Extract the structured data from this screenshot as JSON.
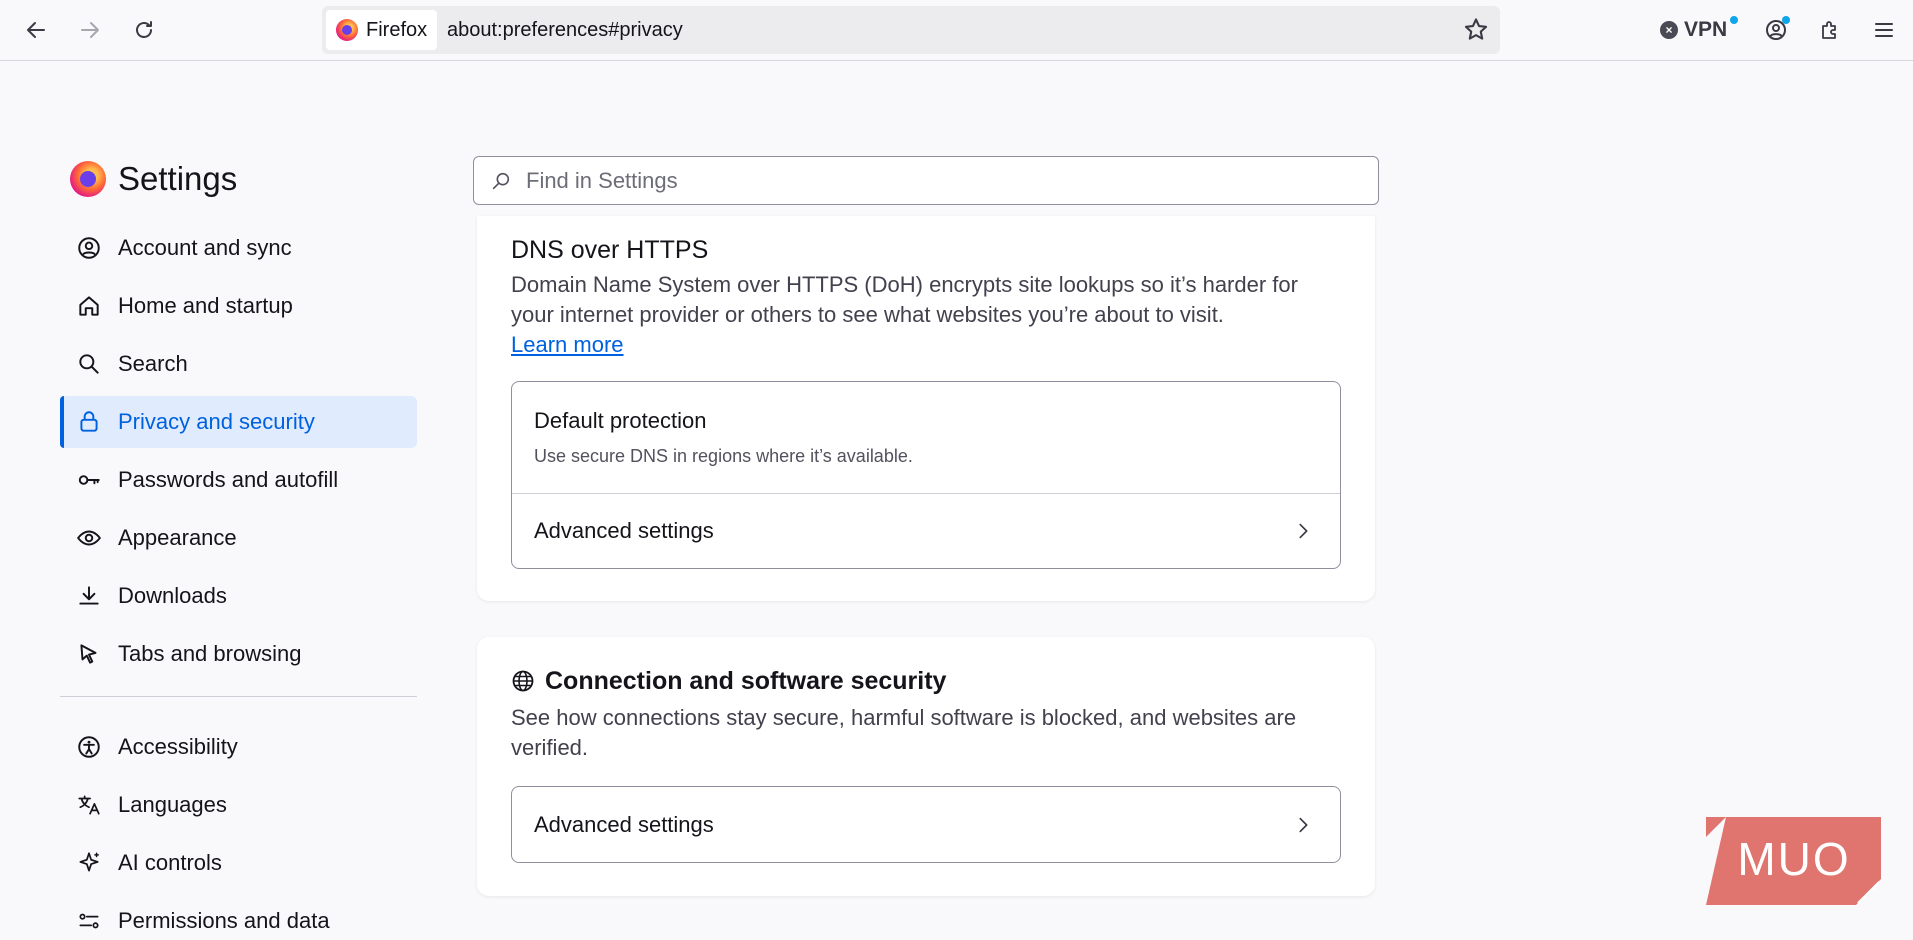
{
  "toolbar": {
    "identity_label": "Firefox",
    "url": "about:preferences#privacy",
    "vpn_label": "VPN"
  },
  "sidebar": {
    "title": "Settings",
    "items": [
      {
        "label": "Account and sync",
        "icon": "account-icon"
      },
      {
        "label": "Home and startup",
        "icon": "home-icon"
      },
      {
        "label": "Search",
        "icon": "search-icon"
      },
      {
        "label": "Privacy and security",
        "icon": "lock-icon",
        "active": true
      },
      {
        "label": "Passwords and autofill",
        "icon": "key-icon"
      },
      {
        "label": "Appearance",
        "icon": "eye-icon"
      },
      {
        "label": "Downloads",
        "icon": "download-icon"
      },
      {
        "label": "Tabs and browsing",
        "icon": "cursor-icon"
      }
    ],
    "items2": [
      {
        "label": "Accessibility",
        "icon": "accessibility-icon"
      },
      {
        "label": "Languages",
        "icon": "languages-icon"
      },
      {
        "label": "AI controls",
        "icon": "sparkle-icon"
      },
      {
        "label": "Permissions and data",
        "icon": "permissions-icon"
      }
    ]
  },
  "search": {
    "placeholder": "Find in Settings"
  },
  "dns": {
    "title": "DNS over HTTPS",
    "description": "Domain Name System over HTTPS (DoH) encrypts site lookups so it’s harder for your internet provider or others to see what websites you’re about to visit.",
    "learn_more": "Learn more",
    "default_title": "Default protection",
    "default_sub": "Use secure DNS in regions where it’s available.",
    "advanced": "Advanced settings"
  },
  "connection": {
    "title": "Connection and software security",
    "description": "See how connections stay secure, harmful software is blocked, and websites are verified.",
    "advanced": "Advanced settings"
  },
  "watermark": {
    "text": "MUO",
    "color": "#d9534f"
  },
  "colors": {
    "accent": "#0061e0",
    "active_bg": "#e0ecfd"
  }
}
